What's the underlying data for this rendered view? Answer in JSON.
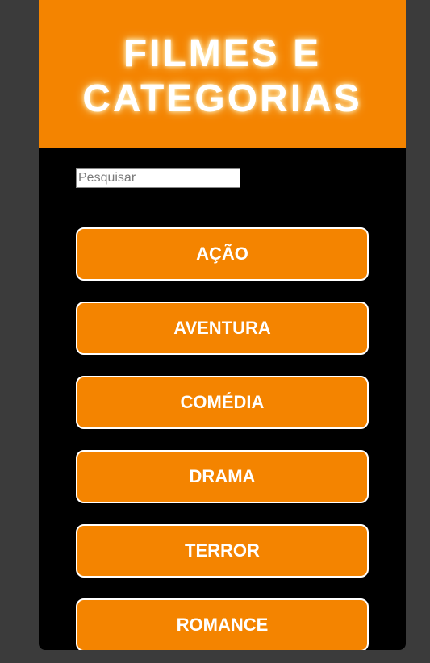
{
  "header": {
    "title": "FILMES E\nCATEGORIAS"
  },
  "search": {
    "placeholder": "Pesquisar",
    "value": ""
  },
  "categories": [
    {
      "label": "AÇÃO"
    },
    {
      "label": "AVENTURA"
    },
    {
      "label": "COMÉDIA"
    },
    {
      "label": "DRAMA"
    },
    {
      "label": "TERROR"
    },
    {
      "label": "ROMANCE"
    }
  ],
  "colors": {
    "accent": "#f48400",
    "background": "#3b3b3b",
    "card": "#000000",
    "text": "#ffffff"
  }
}
